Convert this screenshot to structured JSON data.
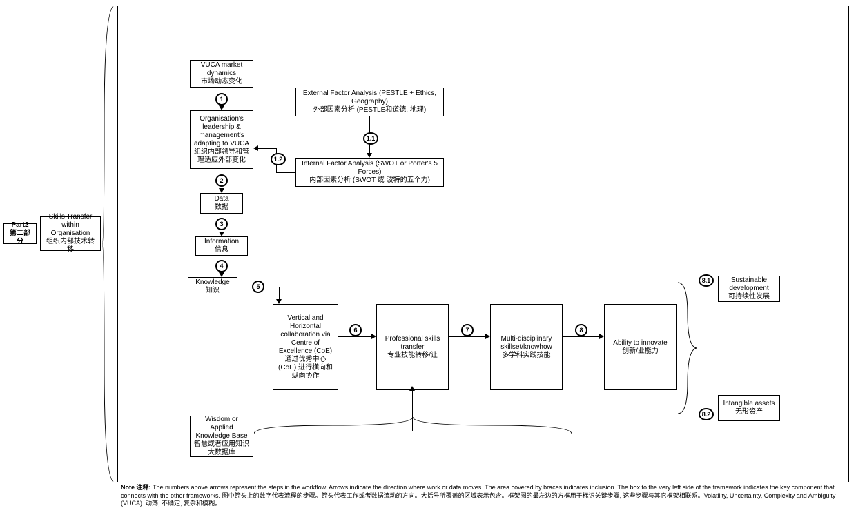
{
  "sidebar": {
    "part_en": "Part2",
    "part_cn": "第二部分",
    "transfer_en": "Skills Transfer within Organisation",
    "transfer_cn": "组织内部技术转移"
  },
  "boxes": {
    "vuca": {
      "en": "VUCA market dynamics",
      "cn": "市场动态变化"
    },
    "leadership": {
      "en": "Organisation's leadership & management's adapting to VUCA",
      "cn": "组织内部领导和管理适应外部变化"
    },
    "data": {
      "en": "Data",
      "cn": "数据"
    },
    "info": {
      "en": "Information",
      "cn": "信息"
    },
    "knowledge": {
      "en": "Knowledge",
      "cn": "知识"
    },
    "collab": {
      "en": "Vertical and Horizontal collaboration via Centre of Excellence (CoE)",
      "cn": "通过优秀中心 (CoE) 进行横向和纵向协作"
    },
    "wisdom": {
      "en": "Wisdom or Applied Knowledge Base",
      "cn": "智慧或者应用知识大数据库"
    },
    "external": {
      "en": "External Factor Analysis (PESTLE + Ethics, Geography)",
      "cn": "外部因素分析 (PESTLE和道德, 地理)"
    },
    "internal": {
      "en": "Internal Factor Analysis (SWOT or Porter's 5 Forces)",
      "cn": "内部因素分析 (SWOT 或 波特的五个力)"
    },
    "skills": {
      "en": "Professional skills transfer",
      "cn": "专业技能转移/让"
    },
    "multi": {
      "en": "Multi-disciplinary skillset/knowhow",
      "cn": "多学科实践技能"
    },
    "innovate": {
      "en": "Ability to innovate",
      "cn": "创新/业能力"
    },
    "sustain": {
      "en": "Sustainable development",
      "cn": "可持续性发展"
    },
    "intang": {
      "en": "Intangible assets",
      "cn": "无形资产"
    }
  },
  "steps": {
    "s1": "1",
    "s1_1": "1.1",
    "s1_2": "1.2",
    "s2": "2",
    "s3": "3",
    "s4": "4",
    "s5": "5",
    "s6": "6",
    "s7": "7",
    "s8": "8",
    "s8_1": "8.1",
    "s8_2": "8.2"
  },
  "note": {
    "prefix": "Note 注释:",
    "text_en": "The numbers above arrows represent the steps in the workflow. Arrows indicate the direction where work or data moves. The area covered by braces indicates inclusion. The box to the very left side of the framework indicates the key component that connects with the other frameworks.",
    "text_cn": "图中箭头上的数字代表流程的步骤。箭头代表工作或者数据流动的方向。大括号所覆盖的区域表示包含。框架图的最左边的方框用于标识关键步骤, 这些步骤与其它框架相联系。Volatility, Uncertainty, Complexity and Ambiguity (VUCA): 动荡, 不确定, 复杂和模糊。"
  }
}
